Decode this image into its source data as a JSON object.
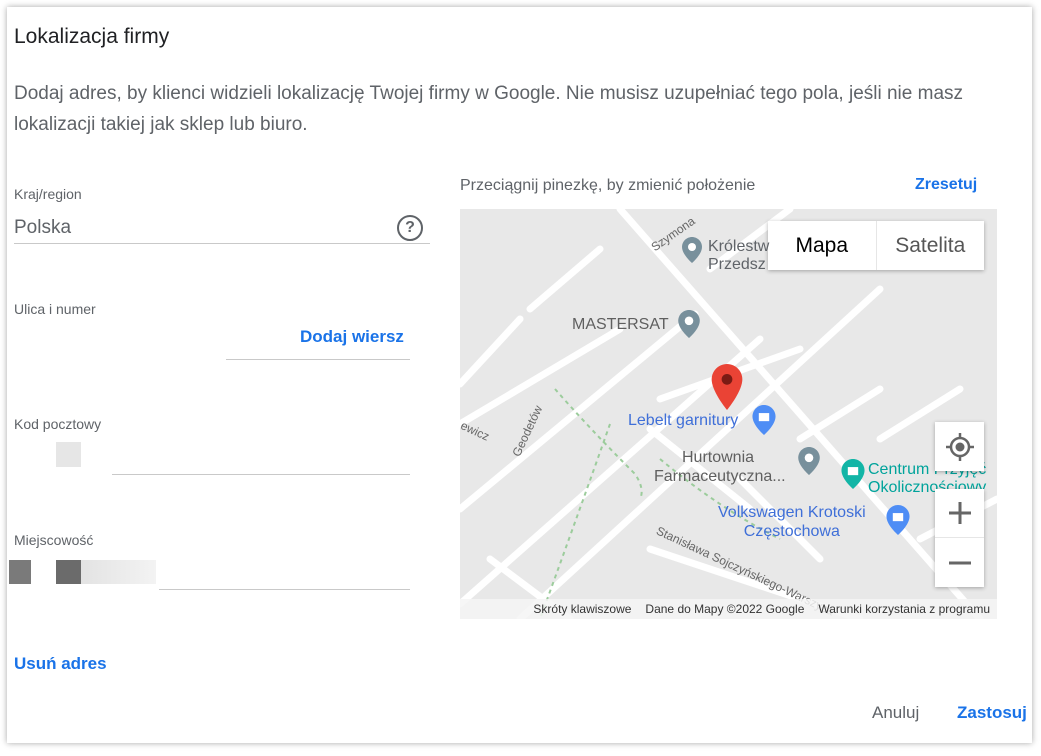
{
  "dialog": {
    "title": "Lokalizacja firmy",
    "description": "Dodaj adres, by klienci widzieli lokalizację Twojej firmy w Google. Nie musisz uzupełniać tego pola, jeśli nie masz lokalizacji takiej jak sklep lub biuro."
  },
  "form": {
    "country_label": "Kraj/region",
    "country_value": "Polska",
    "street_label": "Ulica i numer",
    "add_line": "Dodaj wiersz",
    "postal_label": "Kod pocztowy",
    "city_label": "Miejscowość",
    "remove_address": "Usuń adres"
  },
  "map": {
    "hint": "Przeciągnij pinezkę, by zmienić położenie",
    "reset": "Zresetuj",
    "type_map": "Mapa",
    "type_satellite": "Satelita",
    "places": {
      "krolestwo_1": "Królestw",
      "krolestwo_2": "Przedsz",
      "mastersat": "MASTERSAT",
      "lebelt": "Lebelt garnitury",
      "hurtownia_1": "Hurtownia",
      "hurtownia_2": "Farmaceutyczna...",
      "centrum_1": "Centrum Przyjęć",
      "centrum_2": "Okolicznościowy",
      "vw_1": "Volkswagen Krotoski",
      "vw_2": "Częstochowa"
    },
    "streets": {
      "szymona": "Szymona",
      "geodetow": "Geodetów",
      "ewicz": "ewicz",
      "sojczynskiego": "Stanisława Sojczyńskiego-Warszyca"
    },
    "footer": {
      "shortcuts": "Skróty klawiszowe",
      "data": "Dane do Mapy ©2022 Google",
      "terms": "Warunki korzystania z programu"
    }
  },
  "actions": {
    "cancel": "Anuluj",
    "apply": "Zastosuj"
  },
  "colors": {
    "accent": "#1a73e8",
    "pin": "#ea4335"
  }
}
